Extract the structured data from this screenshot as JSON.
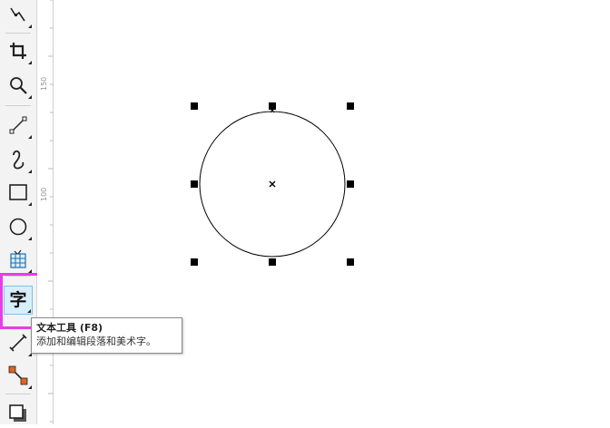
{
  "toolbox": {
    "tools": [
      {
        "name": "shape-tool",
        "icon": "shape-edit-icon"
      },
      {
        "name": "crop-tool",
        "icon": "crop-icon"
      },
      {
        "name": "zoom-tool",
        "icon": "magnifier-icon"
      },
      {
        "name": "freehand-tool",
        "icon": "line-node-icon"
      },
      {
        "name": "artistic-media-tool",
        "icon": "curve-icon"
      },
      {
        "name": "rectangle-tool",
        "icon": "rectangle-icon"
      },
      {
        "name": "ellipse-tool",
        "icon": "circle-icon"
      },
      {
        "name": "graph-paper-tool",
        "icon": "table-icon"
      },
      {
        "name": "text-tool",
        "icon": "text-icon",
        "glyph": "字",
        "active": true
      },
      {
        "name": "dimension-tool",
        "icon": "dimension-icon"
      },
      {
        "name": "connector-tool",
        "icon": "connector-icon"
      },
      {
        "name": "shadow-tool",
        "icon": "shadow-icon"
      }
    ],
    "highlight_color": "#e83ce8"
  },
  "ruler": {
    "labels": [
      "150",
      "100"
    ]
  },
  "canvas": {
    "object": "circle"
  },
  "tooltip": {
    "title": "文本工具 (F8)",
    "description": "添加和编辑段落和美术字。"
  }
}
